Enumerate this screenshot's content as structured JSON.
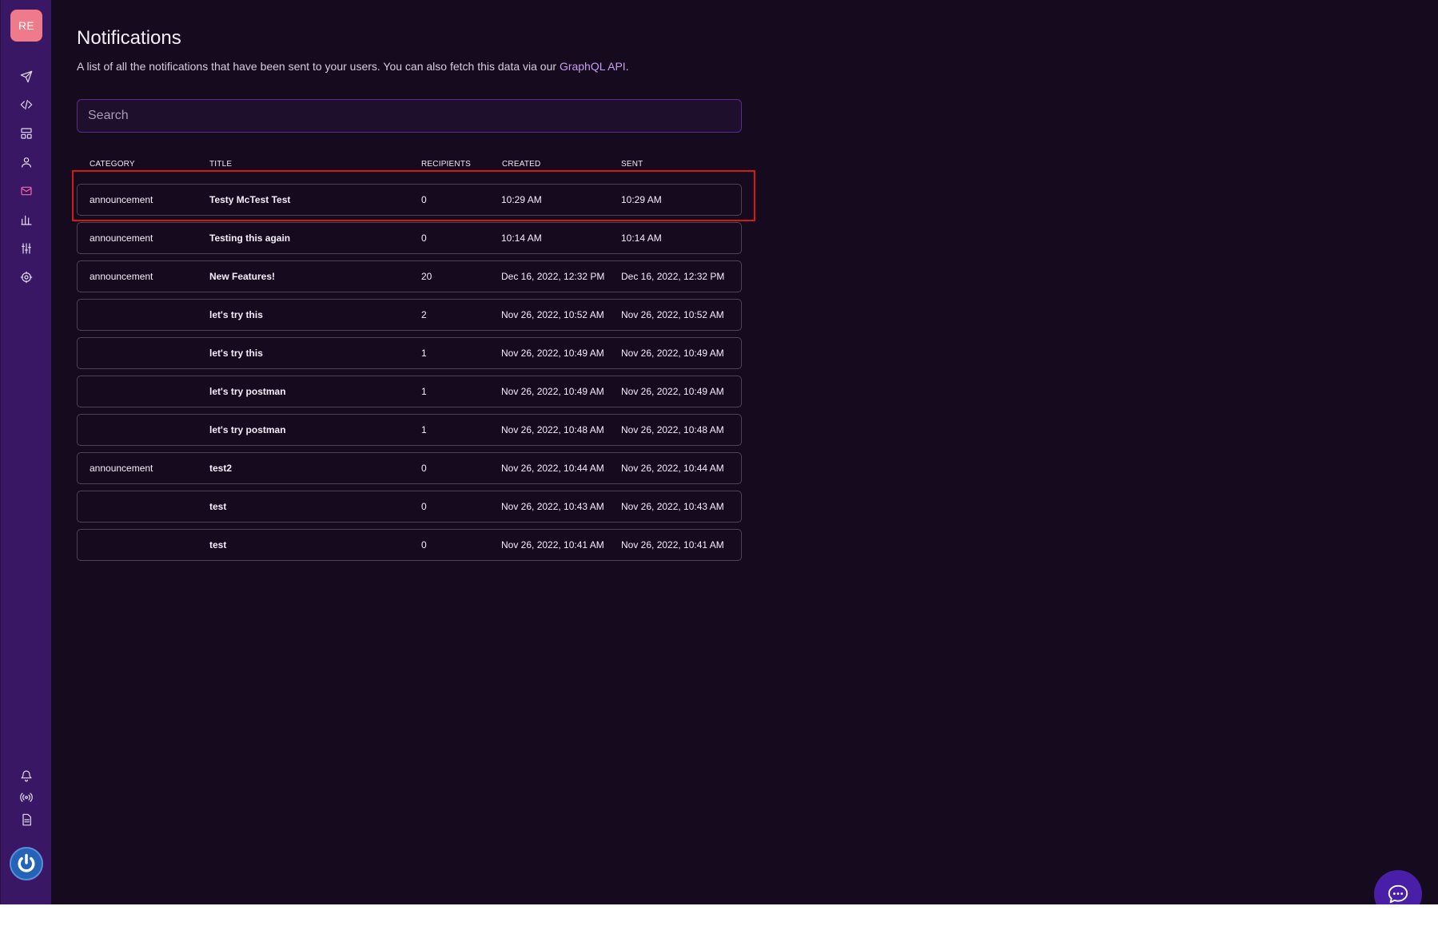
{
  "sidebar": {
    "org_initials": "RE",
    "nav_icons": [
      "send-icon",
      "code-icon",
      "layout-icon",
      "user-icon",
      "mail-icon",
      "bar-chart-icon",
      "sliders-icon",
      "settings-icon"
    ],
    "active_icon": "mail-icon",
    "bottom_icons": [
      "bell-icon",
      "broadcast-icon",
      "document-icon"
    ]
  },
  "page": {
    "title": "Notifications",
    "description": "A list of all the notifications that have been sent to your users. You can also fetch this data via our ",
    "link_text": "GraphQL API",
    "description_end": "."
  },
  "search": {
    "placeholder": "Search",
    "value": ""
  },
  "table": {
    "headers": {
      "category": "CATEGORY",
      "title": "TITLE",
      "recipients": "RECIPIENTS",
      "created": "CREATED",
      "sent": "SENT"
    },
    "rows": [
      {
        "category": "announcement",
        "title": "Testy McTest Test",
        "recipients": "0",
        "created": "10:29 AM",
        "sent": "10:29 AM"
      },
      {
        "category": "announcement",
        "title": "Testing this again",
        "recipients": "0",
        "created": "10:14 AM",
        "sent": "10:14 AM"
      },
      {
        "category": "announcement",
        "title": "New Features!",
        "recipients": "20",
        "created": "Dec 16, 2022, 12:32 PM",
        "sent": "Dec 16, 2022, 12:32 PM"
      },
      {
        "category": "",
        "title": "let's try this",
        "recipients": "2",
        "created": "Nov 26, 2022, 10:52 AM",
        "sent": "Nov 26, 2022, 10:52 AM"
      },
      {
        "category": "",
        "title": "let's try this",
        "recipients": "1",
        "created": "Nov 26, 2022, 10:49 AM",
        "sent": "Nov 26, 2022, 10:49 AM"
      },
      {
        "category": "",
        "title": "let's try postman",
        "recipients": "1",
        "created": "Nov 26, 2022, 10:49 AM",
        "sent": "Nov 26, 2022, 10:49 AM"
      },
      {
        "category": "",
        "title": "let's try postman",
        "recipients": "1",
        "created": "Nov 26, 2022, 10:48 AM",
        "sent": "Nov 26, 2022, 10:48 AM"
      },
      {
        "category": "announcement",
        "title": "test2",
        "recipients": "0",
        "created": "Nov 26, 2022, 10:44 AM",
        "sent": "Nov 26, 2022, 10:44 AM"
      },
      {
        "category": "",
        "title": "test",
        "recipients": "0",
        "created": "Nov 26, 2022, 10:43 AM",
        "sent": "Nov 26, 2022, 10:43 AM"
      },
      {
        "category": "",
        "title": "test",
        "recipients": "0",
        "created": "Nov 26, 2022, 10:41 AM",
        "sent": "Nov 26, 2022, 10:41 AM"
      }
    ]
  },
  "colors": {
    "background": "#160b1e",
    "sidebar": "#3a1764",
    "accent_link": "#c89cf0",
    "active_nav": "#f06aa8",
    "highlight_box": "#d11a1a",
    "chat_button": "#4a1fa8"
  },
  "chat": {
    "icon": "chat-bubble-icon"
  }
}
